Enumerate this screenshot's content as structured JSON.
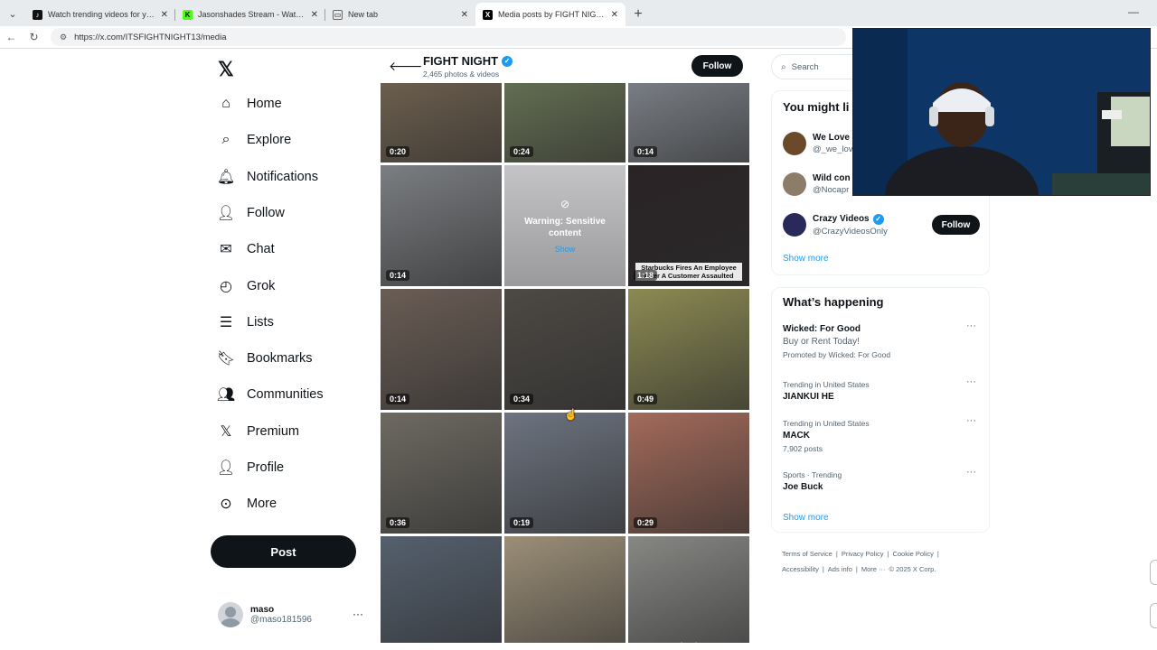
{
  "browser": {
    "tabs": [
      {
        "title": "Watch trending videos for you | Ti",
        "icon": "tiktok-icon",
        "active": false
      },
      {
        "title": "Jasonshades Stream - Watch Live",
        "icon": "kick-icon",
        "active": false
      },
      {
        "title": "New tab",
        "icon": "newtab-icon",
        "active": false
      },
      {
        "title": "Media posts by FIGHT NIGHT (@IT",
        "icon": "x-icon",
        "active": true
      }
    ],
    "url": "https://x.com/ITSFIGHTNIGHT13/media"
  },
  "sidebar": {
    "items": [
      {
        "label": "Home",
        "icon": "home-icon"
      },
      {
        "label": "Explore",
        "icon": "search-icon"
      },
      {
        "label": "Notifications",
        "icon": "bell-icon"
      },
      {
        "label": "Follow",
        "icon": "person-add-icon"
      },
      {
        "label": "Chat",
        "icon": "mail-icon"
      },
      {
        "label": "Grok",
        "icon": "grok-icon"
      },
      {
        "label": "Lists",
        "icon": "list-icon"
      },
      {
        "label": "Bookmarks",
        "icon": "bookmark-icon"
      },
      {
        "label": "Communities",
        "icon": "communities-icon"
      },
      {
        "label": "Premium",
        "icon": "x-premium-icon"
      },
      {
        "label": "Profile",
        "icon": "person-icon"
      },
      {
        "label": "More",
        "icon": "more-circle-icon"
      }
    ],
    "post_label": "Post",
    "account": {
      "name": "maso",
      "handle": "@maso181596"
    }
  },
  "profile_header": {
    "name": "FIGHT NIGHT",
    "subtitle": "2,465 photos & videos",
    "follow_label": "Follow"
  },
  "media": [
    {
      "duration": "0:20",
      "color": "#7a6a55"
    },
    {
      "duration": "0:24",
      "color": "#6f7c5a"
    },
    {
      "duration": "0:14",
      "color": "#8a9098"
    },
    {
      "duration": "0:14",
      "color": "#7b7e82"
    },
    {
      "duration": "",
      "color": "#b9b9bb",
      "warning": true
    },
    {
      "duration": "1:18",
      "color": "#2a2326",
      "caption": "Starbucks Fires An Employee After A Customer Assaulted"
    },
    {
      "duration": "0:14",
      "color": "#6a5d55"
    },
    {
      "duration": "0:34",
      "color": "#4d4944"
    },
    {
      "duration": "0:49",
      "color": "#8c8a52"
    },
    {
      "duration": "0:36",
      "color": "#6e6a62"
    },
    {
      "duration": "0:19",
      "color": "#6d7480"
    },
    {
      "duration": "0:29",
      "color": "#a36a5a"
    },
    {
      "duration": "",
      "color": "#55606e"
    },
    {
      "duration": "",
      "color": "#9c8f78"
    },
    {
      "duration": "",
      "color": "#878784",
      "quote": "\"F***ing loser\""
    }
  ],
  "warning": {
    "text": "Warning: Sensitive content",
    "show": "Show"
  },
  "search": {
    "placeholder": "Search"
  },
  "suggestions": {
    "title": "You might li",
    "users": [
      {
        "name": "We Love",
        "handle": "@_we_lov",
        "color": "#6b4a2c",
        "verified": false
      },
      {
        "name": "Wild con",
        "handle": "@Nocapr",
        "color": "#8c7c6a",
        "verified": false
      },
      {
        "name": "Crazy Videos",
        "handle": "@CrazyVideosOnly",
        "color": "#2a2a5a",
        "verified": true,
        "follow_label": "Follow"
      }
    ],
    "show_more": "Show more"
  },
  "happening": {
    "title": "What’s happening",
    "trends": [
      {
        "meta": "",
        "title": "Wicked: For Good",
        "sub": "Buy or Rent Today!",
        "promo": "Promoted by Wicked: For Good"
      },
      {
        "meta": "Trending in United States",
        "title": "JIANKUI HE"
      },
      {
        "meta": "Trending in United States",
        "title": "MACK",
        "count": "7,902 posts"
      },
      {
        "meta": "Sports · Trending",
        "title": "Joe Buck"
      }
    ],
    "show_more": "Show more"
  },
  "footer": {
    "links": [
      "Terms of Service",
      "|",
      "Privacy Policy",
      "|",
      "Cookie Policy",
      "|",
      "Accessibility",
      "|",
      "Ads info",
      "|",
      "More ···",
      "© 2025 X Corp."
    ]
  },
  "colors": {
    "accent": "#1d9bf0",
    "text": "#0f1419",
    "muted": "#536471",
    "dark_button": "#0f1419"
  }
}
